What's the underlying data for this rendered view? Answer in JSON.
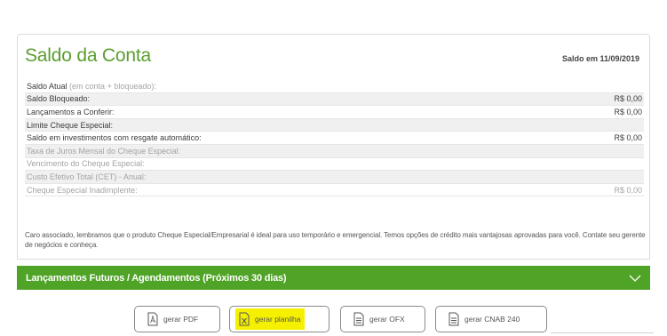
{
  "card": {
    "title": "Saldo da Conta",
    "date_label": "Saldo em 11/09/2019",
    "rows": [
      {
        "label": "Saldo Atual",
        "sub": " (em conta + bloqueado):",
        "value": ""
      },
      {
        "label": "Saldo Bloqueado:",
        "sub": "",
        "value": "R$ 0,00"
      },
      {
        "label": "Lançamentos a Conferir:",
        "sub": "",
        "value": "R$ 0,00"
      },
      {
        "label": "Limite Cheque Especial:",
        "sub": "",
        "value": ""
      },
      {
        "label": "Saldo em investimentos com resgate automático:",
        "sub": "",
        "value": "R$ 0,00"
      },
      {
        "label": "Taxa de Juros Mensal do Cheque Especial:",
        "sub": "",
        "value": ""
      },
      {
        "label": "Vencimento do Cheque Especial:",
        "sub": "",
        "value": ""
      },
      {
        "label": "Custo Efetivo Total (CET) - Anual:",
        "sub": "",
        "value": ""
      },
      {
        "label": "Cheque Especial Inadimplente:",
        "sub": "",
        "value": "R$ 0,00"
      }
    ],
    "note": "Caro associado, lembramos que o produto Cheque Especial/Empresarial é ideal para uso temporário e emergencial. Temos opções de crédito mais vantajosas aprovadas para você. Contate seu gerente de negócios e conheça."
  },
  "future": {
    "title": "Lançamentos Futuros / Agendamentos (Próximos 30 dias)",
    "icon": "chevron-down-icon"
  },
  "exports": {
    "pdf": "gerar PDF",
    "planilha": "gerar planilha",
    "ofx": "gerar OFX",
    "cnab": "gerar CNAB 240"
  },
  "colors": {
    "title_green": "#5a9e2f",
    "bar_green": "#4fa326",
    "highlight": "#f5f000"
  }
}
